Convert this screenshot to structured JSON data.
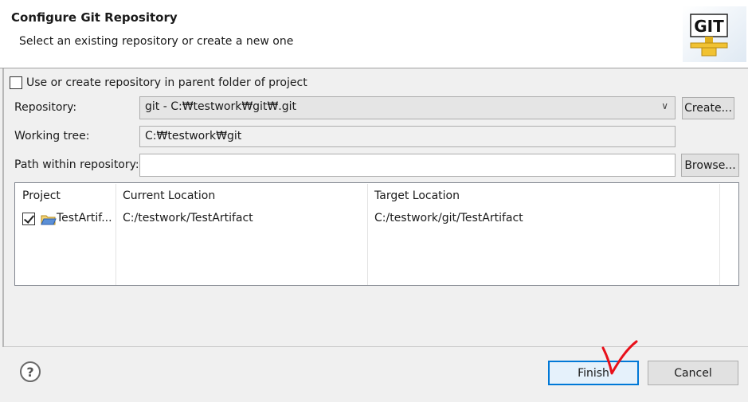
{
  "dialog": {
    "title": "Configure Git Repository",
    "subtitle": "Select an existing repository or create a new one",
    "logo_text": "GIT"
  },
  "options": {
    "use_parent_label": "Use or create repository in parent folder of project",
    "use_parent_checked": false
  },
  "repository": {
    "label": "Repository:",
    "selected": "git - C:₩testwork₩git₩.git",
    "create_button": "Create..."
  },
  "working_tree": {
    "label": "Working tree:",
    "value": "C:₩testwork₩git"
  },
  "path_within": {
    "label": "Path within repository:",
    "value": "",
    "browse_button": "Browse..."
  },
  "table": {
    "headers": [
      "Project",
      "Current Location",
      "Target Location"
    ],
    "rows": [
      {
        "checked": true,
        "project": "TestArtif...",
        "current": "C:/testwork/TestArtifact",
        "target": "C:/testwork/git/TestArtifact"
      }
    ]
  },
  "footer": {
    "help_symbol": "?",
    "finish_button": "Finish",
    "cancel_button": "Cancel"
  },
  "colors": {
    "accent": "#0078d7",
    "annotation_checkmark": "#e8101a"
  }
}
